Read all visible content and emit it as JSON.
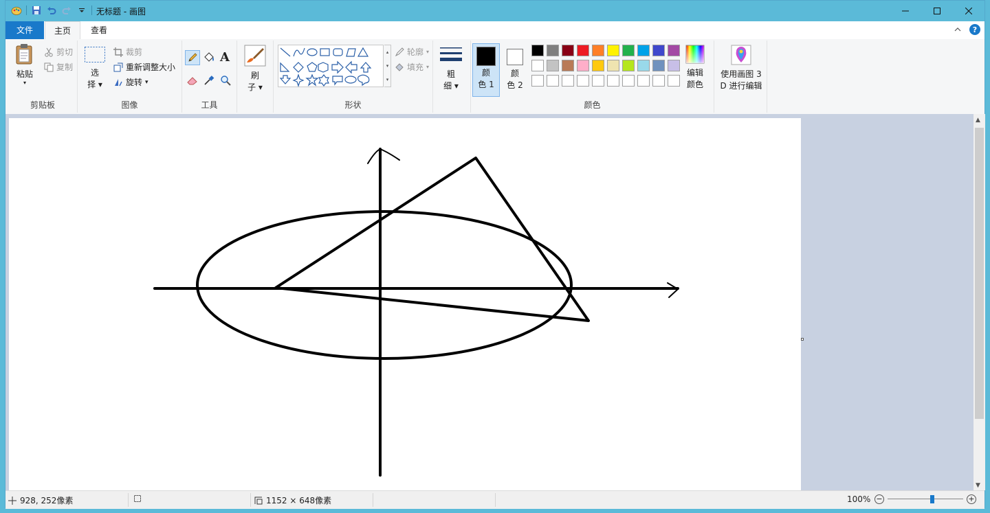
{
  "window": {
    "title": "无标题 - 画图"
  },
  "tabs": {
    "file": "文件",
    "home": "主页",
    "view": "查看"
  },
  "clipboard": {
    "paste": "粘贴",
    "cut": "剪切",
    "copy": "复制",
    "label": "剪贴板"
  },
  "image": {
    "select_1": "选",
    "select_2": "择",
    "crop": "裁剪",
    "resize": "重新调整大小",
    "rotate": "旋转",
    "label": "图像"
  },
  "tools": {
    "label": "工具"
  },
  "brushes": {
    "l1": "刷",
    "l2": "子"
  },
  "shapes": {
    "outline": "轮廓",
    "fill": "填充",
    "label": "形状"
  },
  "size": {
    "l1": "粗",
    "l2": "细"
  },
  "colors": {
    "color1_l1": "颜",
    "color1_l2": "色 1",
    "color2_l1": "颜",
    "color2_l2": "色 2",
    "edit_l1": "编辑",
    "edit_l2": "颜色",
    "label": "颜色",
    "primary": "#000000",
    "secondary": "#ffffff",
    "palette_row1": [
      "#000000",
      "#7f7f7f",
      "#880015",
      "#ed1c24",
      "#ff7f27",
      "#fff200",
      "#22b14c",
      "#00a2e8",
      "#3f48cc",
      "#a349a4"
    ],
    "palette_row2": [
      "#ffffff",
      "#c3c3c3",
      "#b97a57",
      "#ffaec9",
      "#ffc90e",
      "#efe4b0",
      "#b5e61d",
      "#99d9ea",
      "#7092be",
      "#c8bfe7"
    ]
  },
  "paint3d": {
    "l1": "使用画图 3",
    "l2": "D 进行编辑"
  },
  "status": {
    "cursor": "928, 252像素",
    "dimensions": "1152 × 648像素",
    "zoom": "100%"
  }
}
